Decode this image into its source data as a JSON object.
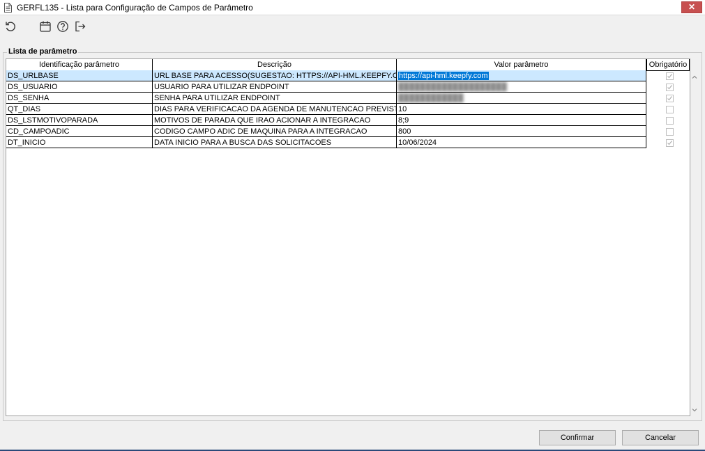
{
  "window": {
    "title": "GERFL135 - Lista para Configuração de Campos de Parâmetro",
    "close_label": "✕"
  },
  "toolbar": {
    "icons": [
      "refresh-icon",
      "calendar-icon",
      "help-icon",
      "exit-icon"
    ]
  },
  "group": {
    "title": "Lista de parâmetro"
  },
  "grid": {
    "columns": [
      "Identificação parâmetro",
      "Descrição",
      "Valor parâmetro",
      "Obrigatório"
    ],
    "rows": [
      {
        "id": "DS_URLBASE",
        "desc": "URL BASE PARA ACESSO(SUGESTAO: HTTPS://API-HML.KEEPFY.COM/API)",
        "value": "https://api-hml.keepfy.com",
        "required": true
      },
      {
        "id": "DS_USUARIO",
        "desc": "USUARIO PARA UTILIZAR ENDPOINT",
        "value": "████████████████████",
        "required": true
      },
      {
        "id": "DS_SENHA",
        "desc": "SENHA PARA UTILIZAR ENDPOINT",
        "value": "████████████",
        "required": true
      },
      {
        "id": "QT_DIAS",
        "desc": "DIAS PARA VERIFICACAO DA AGENDA DE MANUTENCAO PREVISTA",
        "value": "10",
        "required": false
      },
      {
        "id": "DS_LSTMOTIVOPARADA",
        "desc": "MOTIVOS DE PARADA QUE IRAO ACIONAR A INTEGRACAO",
        "value": "8;9",
        "required": false
      },
      {
        "id": "CD_CAMPOADIC",
        "desc": "CODIGO CAMPO ADIC DE MAQUINA PARA A INTEGRACAO",
        "value": "800",
        "required": false
      },
      {
        "id": "DT_INICIO",
        "desc": "DATA INICIO PARA A BUSCA DAS SOLICITACOES",
        "value": "10/06/2024",
        "required": true
      }
    ]
  },
  "buttons": {
    "confirm": "Confirmar",
    "cancel": "Cancelar"
  },
  "colors": {
    "selection": "#0078d7",
    "row_highlight": "#cce8ff",
    "close": "#c75050"
  }
}
